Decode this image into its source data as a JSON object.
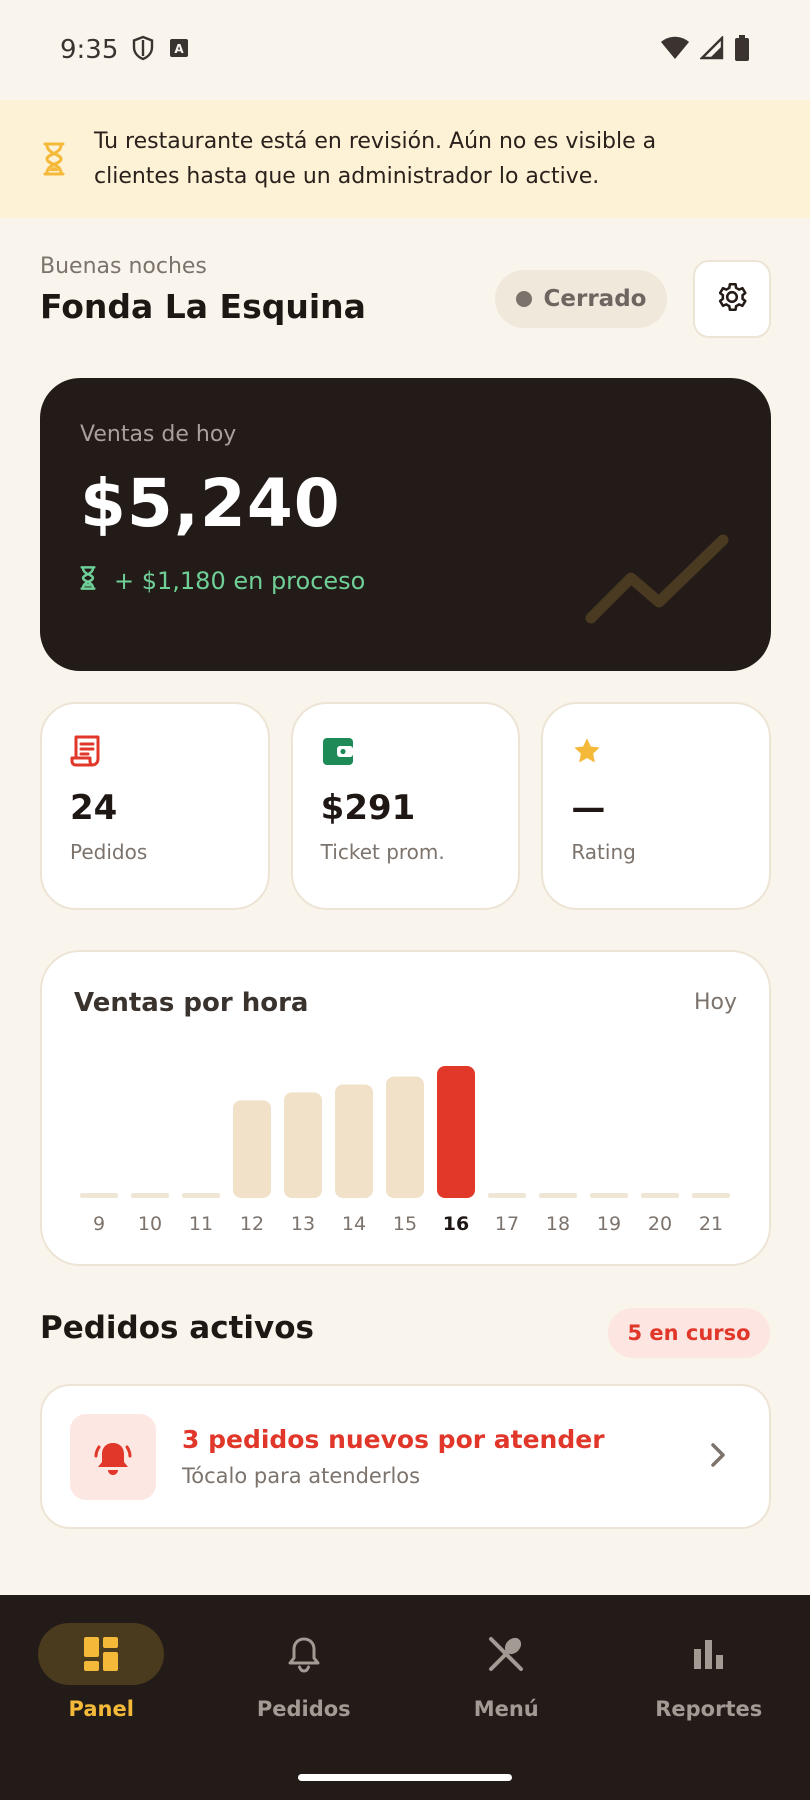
{
  "status_bar": {
    "time": "9:35"
  },
  "banner": {
    "text": "Tu restaurante está en revisión. Aún no es visible a clientes hasta que un administrador lo active."
  },
  "header": {
    "greeting": "Buenas noches",
    "restaurant_name": "Fonda La Esquina",
    "status_label": "Cerrado"
  },
  "sales": {
    "label": "Ventas de hoy",
    "value": "$5,240",
    "pending": "+ $1,180 en proceso"
  },
  "stats": [
    {
      "value": "24",
      "label": "Pedidos",
      "icon": "receipt-icon"
    },
    {
      "value": "$291",
      "label": "Ticket prom.",
      "icon": "wallet-icon"
    },
    {
      "value": "—",
      "label": "Rating",
      "icon": "star-icon"
    }
  ],
  "chart_data": {
    "type": "bar",
    "title": "Ventas por hora",
    "period": "Hoy",
    "categories": [
      "9",
      "10",
      "11",
      "12",
      "13",
      "14",
      "15",
      "16",
      "17",
      "18",
      "19",
      "20",
      "21"
    ],
    "values": [
      0,
      0,
      0,
      74,
      80,
      86,
      92,
      100,
      0,
      0,
      0,
      0,
      0
    ],
    "highlight": "16",
    "colors": {
      "bar": "#f0e1c8",
      "highlight": "#e2382a",
      "empty": "#efe6d6"
    }
  },
  "orders": {
    "title": "Pedidos activos",
    "badge": "5 en curso",
    "alert_title": "3 pedidos nuevos por atender",
    "alert_subtitle": "Tócalo para atenderlos"
  },
  "nav": {
    "items": [
      {
        "label": "Panel",
        "icon": "dashboard-icon",
        "active": true
      },
      {
        "label": "Pedidos",
        "icon": "bell-icon",
        "active": false
      },
      {
        "label": "Menú",
        "icon": "utensils-icon",
        "active": false
      },
      {
        "label": "Reportes",
        "icon": "bar-chart-icon",
        "active": false
      }
    ]
  },
  "colors": {
    "background": "#faf5ec",
    "dark": "#231b18",
    "accent_red": "#e0372a",
    "accent_yellow": "#f5b93a",
    "accent_green": "#1e8a57"
  }
}
